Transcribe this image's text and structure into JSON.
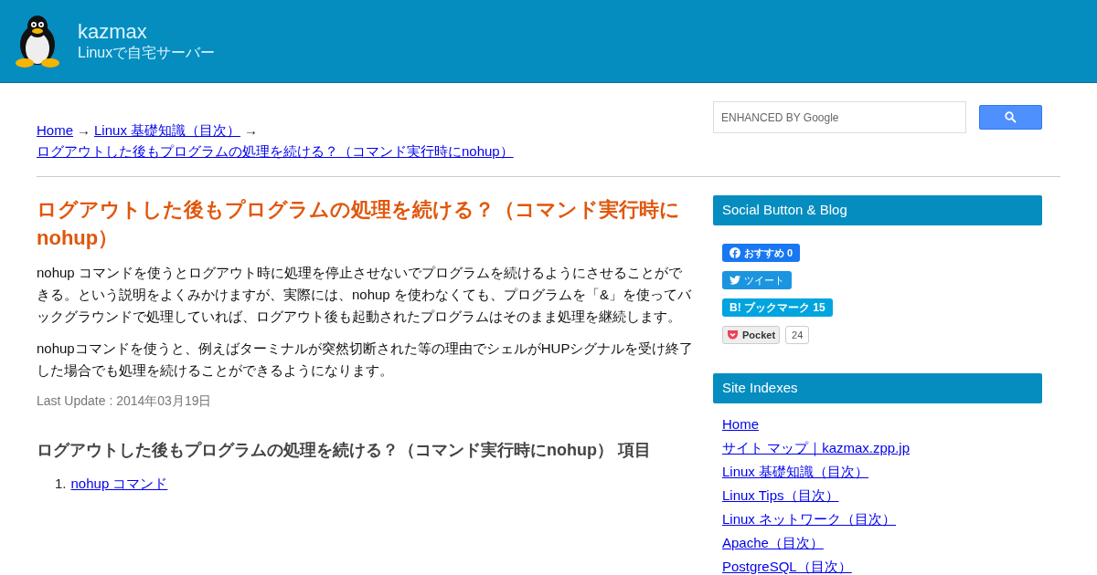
{
  "header": {
    "site_name": "kazmax",
    "tagline": "Linuxで自宅サーバー"
  },
  "breadcrumb": [
    {
      "label": "Home"
    },
    {
      "label": "Linux 基礎知識（目次）"
    },
    {
      "label": "ログアウトした後もプログラムの処理を続ける？（コマンド実行時にnohup）"
    }
  ],
  "breadcrumb_separator": "→",
  "search": {
    "placeholder": "ENHANCED BY Google"
  },
  "article": {
    "title": "ログアウトした後もプログラムの処理を続ける？（コマンド実行時にnohup）",
    "paragraphs": [
      "nohup コマンドを使うとログアウト時に処理を停止させないでプログラムを続けるようにさせることができる。という説明をよくみかけますが、実際には、nohup を使わなくても、プログラムを「&」を使ってバックグラウンドで処理していれば、ログアウト後も起動されたプログラムはそのまま処理を継続します。",
      "nohupコマンドを使うと、例えばターミナルが突然切断された等の理由でシェルがHUPシグナルを受け終了した場合でも処理を続けることができるようになります。"
    ],
    "last_update": "Last Update : 2014年03月19日",
    "toc_heading": "ログアウトした後もプログラムの処理を続ける？（コマンド実行時にnohup） 項目",
    "toc": [
      {
        "marker": "1.",
        "label": "nohup コマンド"
      }
    ]
  },
  "sidebar": {
    "sections": [
      {
        "title": "Social Button & Blog",
        "kind": "social",
        "buttons": [
          {
            "kind": "facebook",
            "label": "おすすめ",
            "count": "0"
          },
          {
            "kind": "twitter",
            "label": "ツイート"
          },
          {
            "kind": "hatena",
            "mark": "B!",
            "label": "ブックマーク",
            "count": "15"
          },
          {
            "kind": "pocket",
            "label": "Pocket",
            "count": "24"
          }
        ]
      },
      {
        "title": "Site Indexes",
        "kind": "links",
        "links": [
          "Home",
          "サイト マップ｜kazmax.zpp.jp",
          "Linux 基礎知識（目次）",
          "Linux Tips（目次）",
          "Linux ネットワーク（目次）",
          "Apache（目次）",
          "PostgreSQL（目次）"
        ]
      }
    ]
  }
}
